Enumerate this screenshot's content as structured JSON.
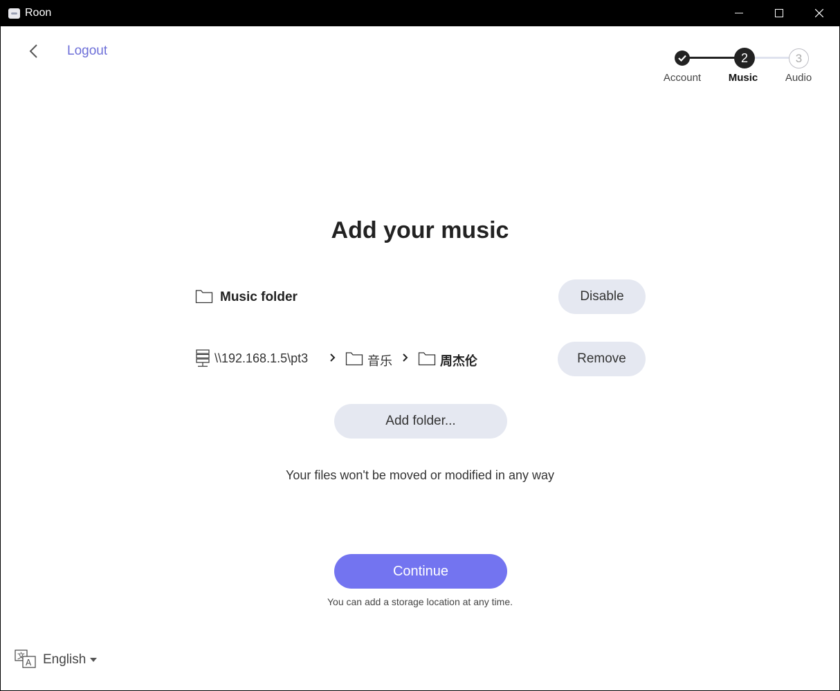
{
  "window": {
    "title": "Roon"
  },
  "header": {
    "back_icon": "chevron-left-icon",
    "logout_label": "Logout",
    "logout_color": "#6d6fd8"
  },
  "stepper": {
    "steps": [
      {
        "number": "1",
        "label": "Account",
        "state": "done"
      },
      {
        "number": "2",
        "label": "Music",
        "state": "current"
      },
      {
        "number": "3",
        "label": "Audio",
        "state": "todo"
      }
    ]
  },
  "main": {
    "title": "Add your music",
    "folders": [
      {
        "icon": "folder-icon",
        "label": "Music folder",
        "action_label": "Disable"
      },
      {
        "path": [
          {
            "icon": "network-drive-icon",
            "label": "\\\\192.168.1.5\\pt3"
          },
          {
            "icon": "folder-icon",
            "label": "音乐"
          },
          {
            "icon": "folder-icon",
            "label": "周杰伦"
          }
        ],
        "action_label": "Remove"
      }
    ],
    "add_folder_label": "Add folder...",
    "note": "Your files won't be moved or modified in any way",
    "continue_label": "Continue",
    "continue_color": "#7374f0",
    "sub_note": "You can add a storage location at any time."
  },
  "footer": {
    "language_icon": "translate-icon",
    "language_label": "English"
  }
}
